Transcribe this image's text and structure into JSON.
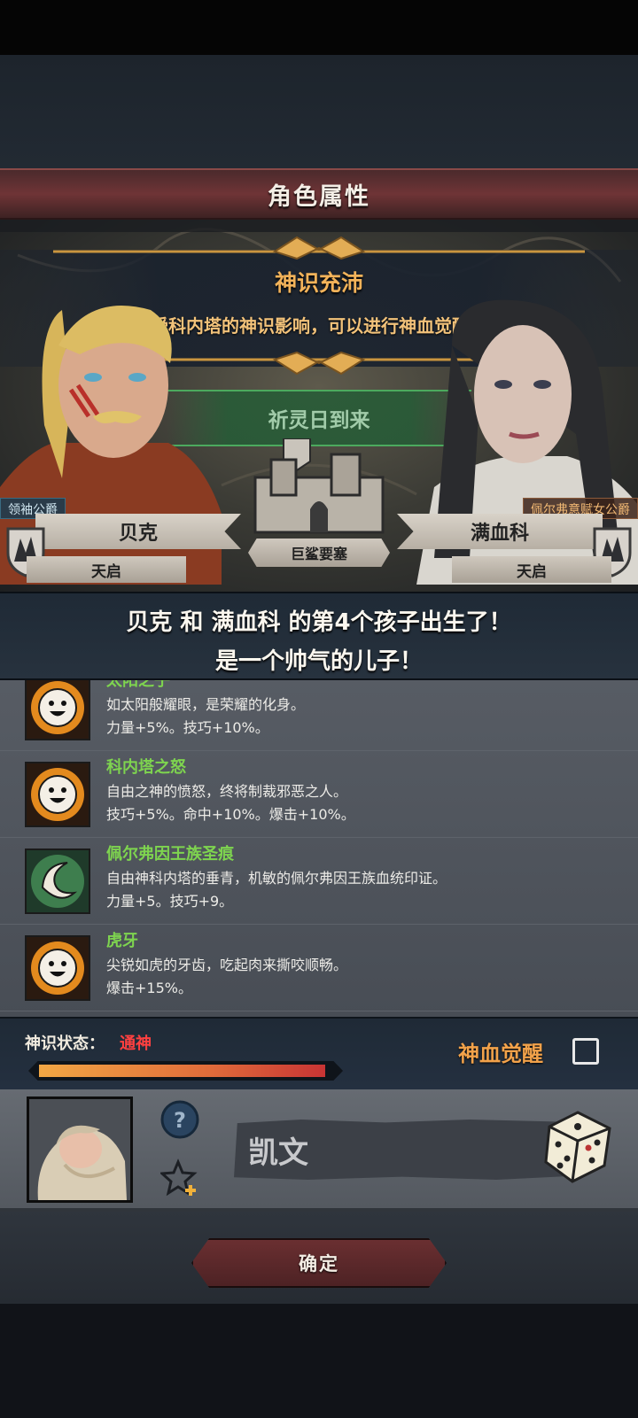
{
  "header": {
    "title": "角色属性"
  },
  "banner": {
    "title": "神识充沛",
    "text": "受科内塔的神识影响，可以进行神血觉醒。"
  },
  "prayer_label": "祈灵日到来",
  "parents": {
    "father": {
      "title": "领袖公爵",
      "name": "贝克",
      "faith": "天启"
    },
    "mother": {
      "title": "佩尔弗意赋女公爵",
      "name": "满血科",
      "faith": "天启"
    }
  },
  "location": "巨鲨要塞",
  "birth": {
    "line1": "贝克 和 满血科 的第4个孩子出生了！",
    "line2": "是一个帅气的儿子！"
  },
  "traits": [
    {
      "icon": "sun-face-icon",
      "name": "太阳之子",
      "desc": "如太阳般耀眼，是荣耀的化身。",
      "bonus": "力量+5%。技巧+10%。"
    },
    {
      "icon": "sun-face-icon",
      "name": "科内塔之怒",
      "desc": "自由之神的愤怒，终将制裁邪恶之人。",
      "bonus": "技巧+5%。命中+10%。爆击+10%。"
    },
    {
      "icon": "crescent-swirl-icon",
      "name": "佩尔弗因王族圣痕",
      "desc": "自由神科内塔的垂青，机敏的佩尔弗因王族血统印证。",
      "bonus": "力量+5。技巧+9。"
    },
    {
      "icon": "sun-face-icon",
      "name": "虎牙",
      "desc": "尖锐如虎的牙齿，吃起肉来撕咬顺畅。",
      "bonus": "爆击+15%。"
    }
  ],
  "status": {
    "label": "神识状态：",
    "value": "通神",
    "level": 1.0,
    "awaken_label": "神血觉醒",
    "awaken_checked": false
  },
  "naming": {
    "name_value": "凯文"
  },
  "confirm_label": "确定",
  "colors": {
    "trait_name": "#7ed44f",
    "status_value": "#ff4040",
    "awaken": "#f2a24a",
    "banner_title": "#f3b35a"
  }
}
